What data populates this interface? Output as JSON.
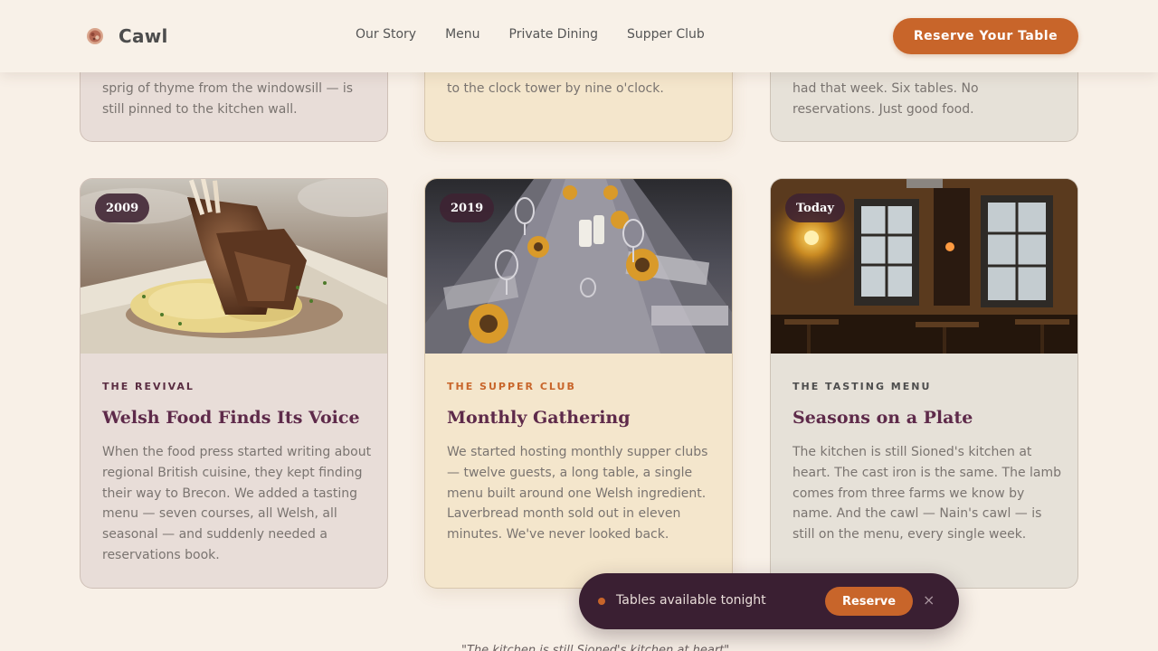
{
  "brand": {
    "name": "Cawl",
    "icon": "bowl-icon"
  },
  "nav": {
    "links": [
      "Our Story",
      "Menu",
      "Private Dining",
      "Supper Club"
    ],
    "cta_label": "Reserve Your Table"
  },
  "top_cards": [
    {
      "text": "sprig of thyme from the windowsill — is still pinned to the kitchen wall."
    },
    {
      "text": "to the clock tower by nine o'clock."
    },
    {
      "text": "had that week. Six tables. No reservations. Just good food."
    }
  ],
  "story_cards": [
    {
      "badge": "2009",
      "eyebrow": "THE REVIVAL",
      "title": "Welsh Food Finds Its Voice",
      "body": "When the food press started writing about regional British cuisine, they kept finding their way to Brecon. We added a tasting menu — seven courses, all Welsh, all seasonal — and suddenly needed a reservations book."
    },
    {
      "badge": "2019",
      "eyebrow": "THE SUPPER CLUB",
      "title": "Monthly Gathering",
      "body": "We started hosting monthly supper clubs — twelve guests, a long table, a single menu built around one Welsh ingredient. Laverbread month sold out in eleven minutes. We've never looked back."
    },
    {
      "badge": "Today",
      "eyebrow": "THE TASTING MENU",
      "title": "Seasons on a Plate",
      "body": "The kitchen is still Sioned's kitchen at heart. The cast iron is the same. The lamb comes from three farms we know by name. And the cawl — Nain's cawl — is still on the menu, every single week."
    }
  ],
  "toast": {
    "message": "Tables available tonight",
    "button_label": "Reserve",
    "close_glyph": "×"
  },
  "footer_quote": "\"The kitchen is still Sioned's kitchen at heart\""
}
